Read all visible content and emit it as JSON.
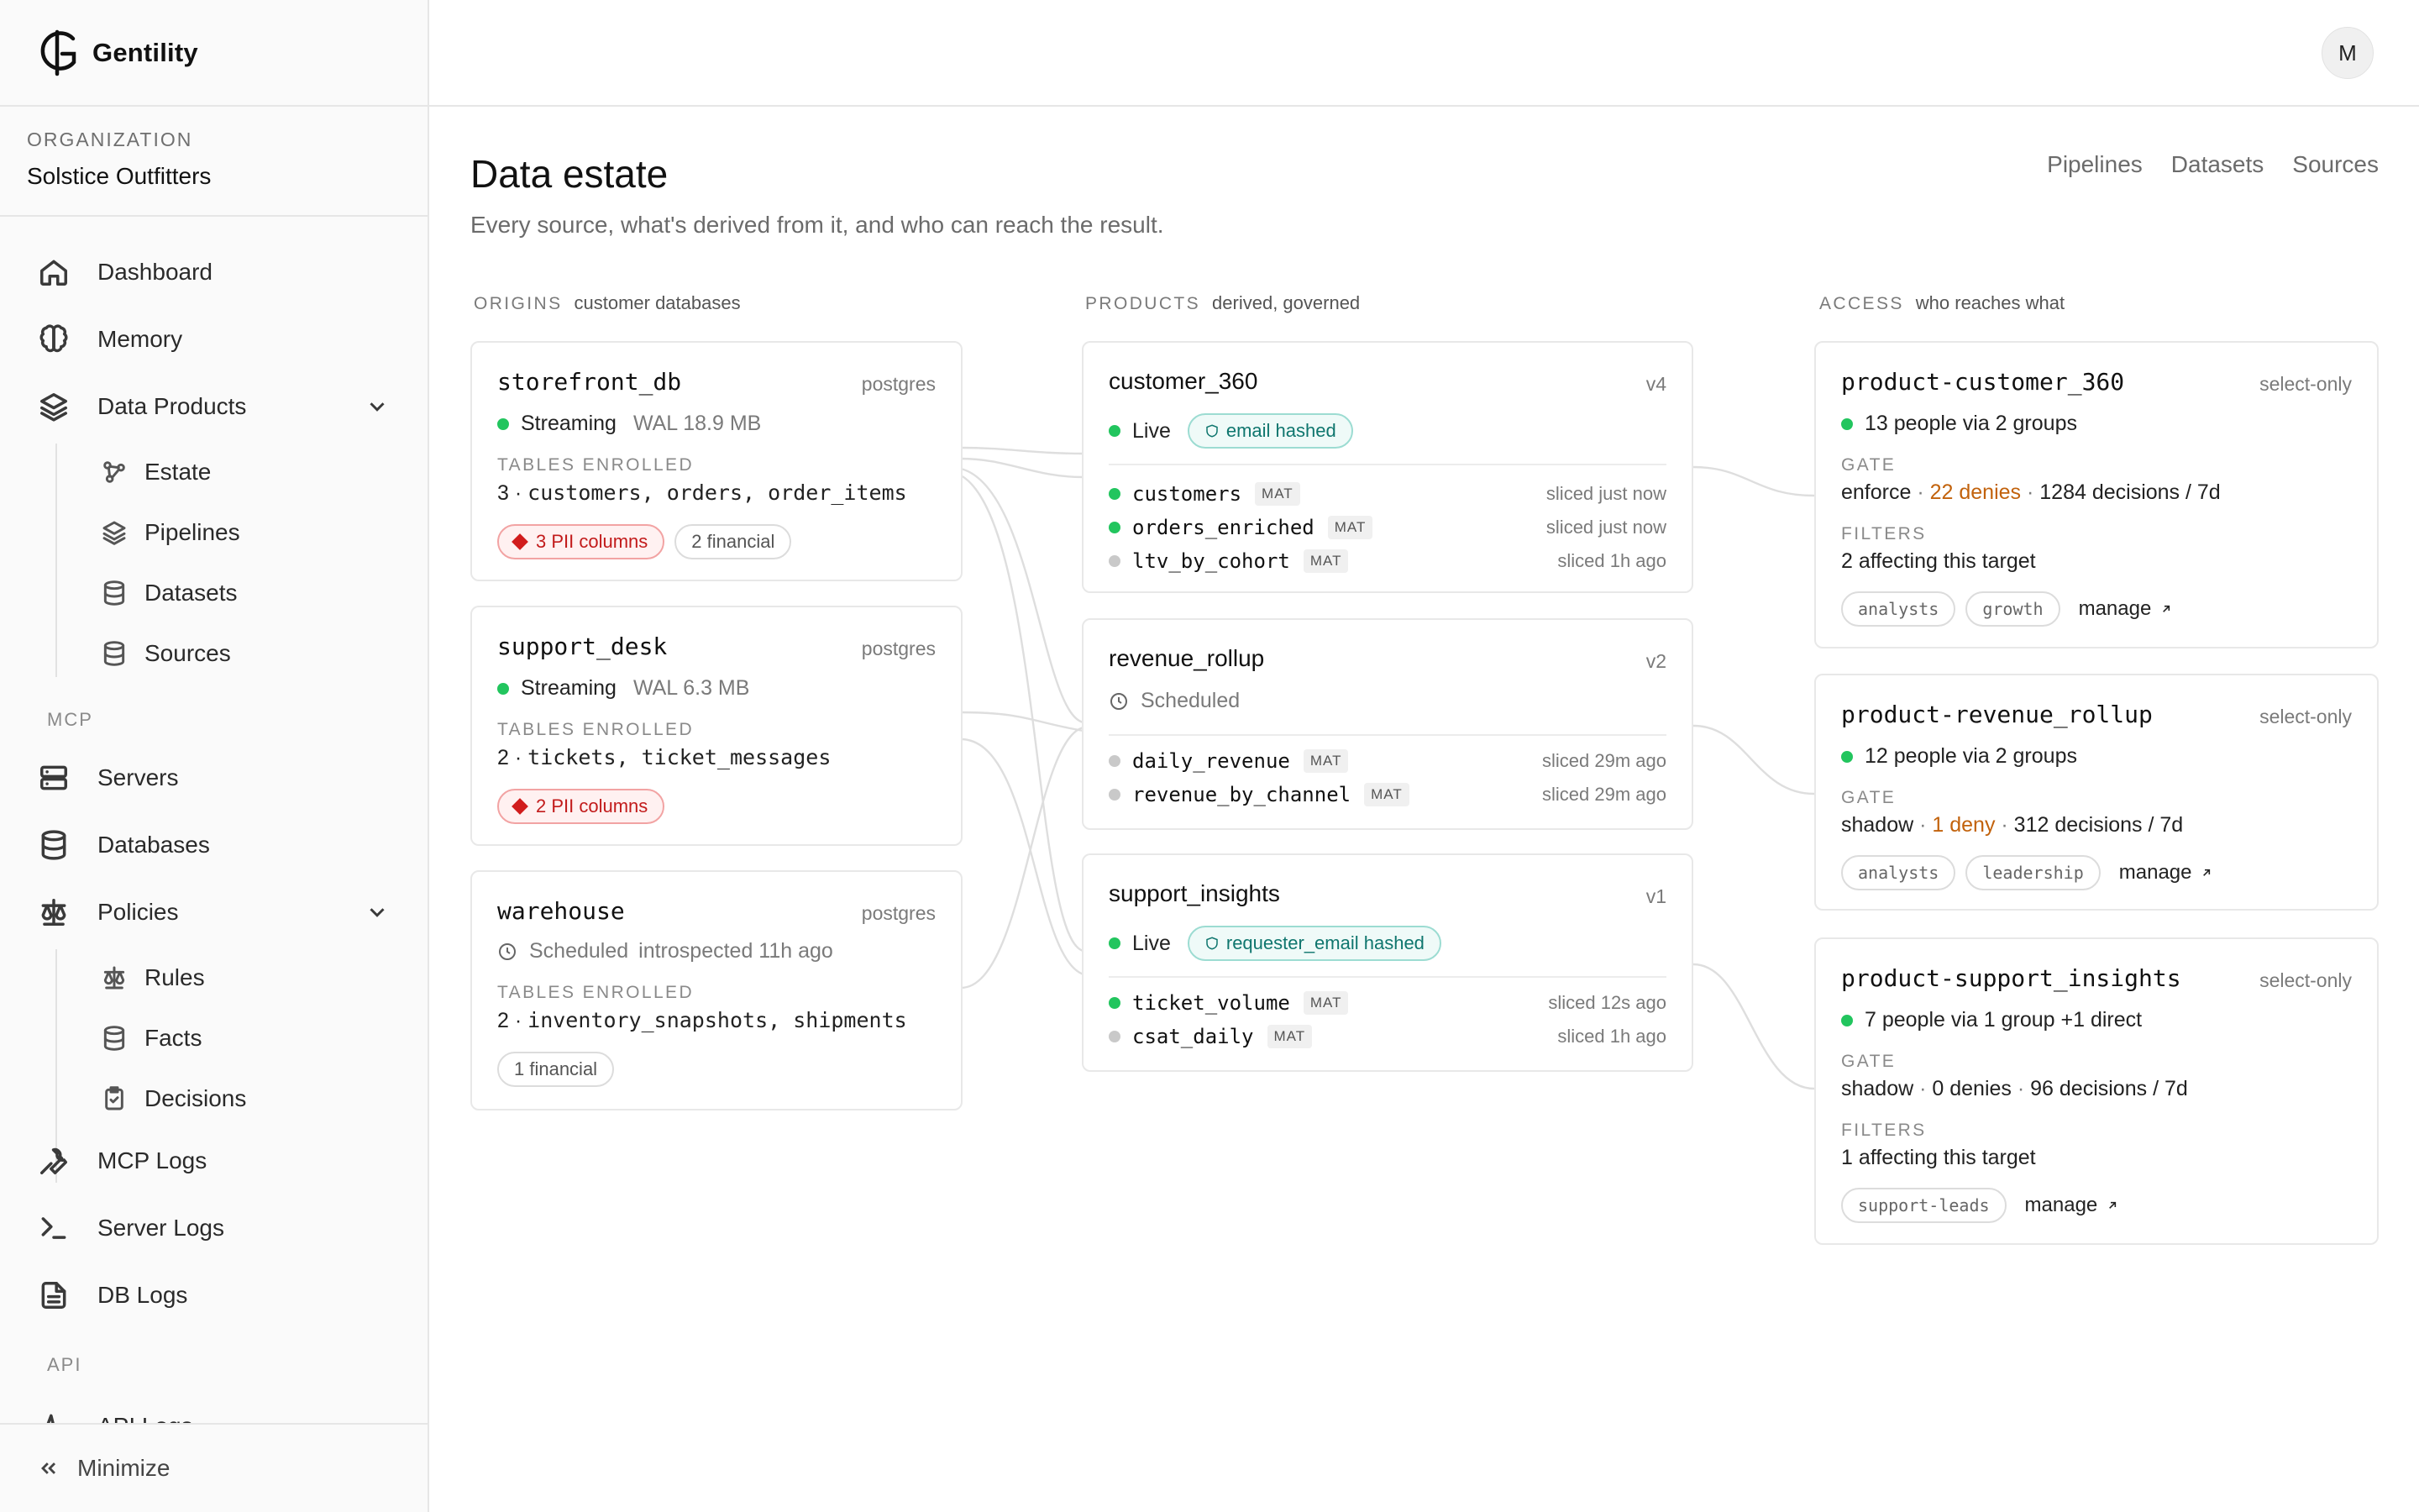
{
  "brand": {
    "name": "Gentility"
  },
  "org": {
    "label": "ORGANIZATION",
    "name": "Solstice Outfitters"
  },
  "nav": {
    "dashboard": "Dashboard",
    "memory": "Memory",
    "data_products": "Data Products",
    "estate": "Estate",
    "pipelines": "Pipelines",
    "datasets": "Datasets",
    "sources": "Sources",
    "section_mcp": "MCP",
    "servers": "Servers",
    "databases": "Databases",
    "policies": "Policies",
    "rules": "Rules",
    "facts": "Facts",
    "decisions": "Decisions",
    "mcp_logs": "MCP Logs",
    "server_logs": "Server Logs",
    "db_logs": "DB Logs",
    "section_api": "API",
    "api_logs": "API Logs",
    "minimize": "Minimize"
  },
  "user": {
    "initial": "M"
  },
  "page": {
    "title": "Data estate",
    "subtitle": "Every source, what's derived from it, and who can reach the result.",
    "links": [
      "Pipelines",
      "Datasets",
      "Sources"
    ]
  },
  "columns": {
    "origins": {
      "key": "ORIGINS",
      "desc": "customer databases"
    },
    "products": {
      "key": "PRODUCTS",
      "desc": "derived, governed"
    },
    "access": {
      "key": "ACCESS",
      "desc": "who reaches what"
    }
  },
  "labels": {
    "tables_enrolled": "TABLES ENROLLED",
    "gate": "GATE",
    "filters": "FILTERS",
    "mat": "MAT",
    "manage": "manage"
  },
  "origins": [
    {
      "name": "storefront_db",
      "engine": "postgres",
      "status": "Streaming",
      "detail": "WAL 18.9 MB",
      "count": "3 ·",
      "tables": "customers, orders, order_items",
      "pii": "3 PII columns",
      "financial": "2 financial"
    },
    {
      "name": "support_desk",
      "engine": "postgres",
      "status": "Streaming",
      "detail": "WAL 6.3 MB",
      "count": "2 ·",
      "tables": "tickets, ticket_messages",
      "pii": "2 PII columns"
    },
    {
      "name": "warehouse",
      "engine": "postgres",
      "status": "Scheduled",
      "detail": "introspected 11h ago",
      "count": "2 ·",
      "tables": "inventory_snapshots, shipments",
      "financial": "1 financial"
    }
  ],
  "products": [
    {
      "name": "customer_360",
      "version": "v4",
      "status": "Live",
      "badge": "email hashed",
      "datasets": [
        {
          "name": "customers",
          "time": "sliced just now",
          "live": true
        },
        {
          "name": "orders_enriched",
          "time": "sliced just now",
          "live": true
        },
        {
          "name": "ltv_by_cohort",
          "time": "sliced 1h ago",
          "live": false
        }
      ]
    },
    {
      "name": "revenue_rollup",
      "version": "v2",
      "status": "Scheduled",
      "datasets": [
        {
          "name": "daily_revenue",
          "time": "sliced 29m ago",
          "live": false
        },
        {
          "name": "revenue_by_channel",
          "time": "sliced 29m ago",
          "live": false
        }
      ]
    },
    {
      "name": "support_insights",
      "version": "v1",
      "status": "Live",
      "badge": "requester_email hashed",
      "datasets": [
        {
          "name": "ticket_volume",
          "time": "sliced 12s ago",
          "live": true
        },
        {
          "name": "csat_daily",
          "time": "sliced 1h ago",
          "live": false
        }
      ]
    }
  ],
  "access": [
    {
      "name": "product-customer_360",
      "mode": "select-only",
      "reach": "13 people via 2 groups",
      "gate_mode": "enforce",
      "denies": "22 denies",
      "decisions": "1284 decisions / 7d",
      "filters": "2 affecting this target",
      "groups": [
        "analysts",
        "growth"
      ]
    },
    {
      "name": "product-revenue_rollup",
      "mode": "select-only",
      "reach": "12 people via 2 groups",
      "gate_mode": "shadow",
      "denies": "1 deny",
      "decisions": "312 decisions / 7d",
      "groups": [
        "analysts",
        "leadership"
      ]
    },
    {
      "name": "product-support_insights",
      "mode": "select-only",
      "reach": "7 people via 1 group +1 direct",
      "gate_mode": "shadow",
      "denies": "0 denies",
      "decisions": "96 decisions / 7d",
      "filters": "1 affecting this target",
      "groups": [
        "support-leads"
      ]
    }
  ],
  "colors": {
    "live": "#22c55e",
    "pii": "#d11d1d",
    "hashed": "#0f766e",
    "deny": "#c2620c"
  }
}
